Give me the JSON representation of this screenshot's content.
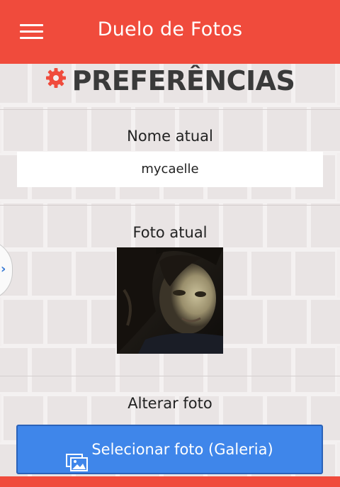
{
  "app": {
    "title": "Duelo de Fotos",
    "accent_color": "#f04b3c",
    "menu_icon": "hamburger-menu-icon"
  },
  "page": {
    "heading": "PREFERÊNCIAS",
    "heading_icon": "gear-icon"
  },
  "current_name": {
    "label": "Nome atual",
    "value": "mycaelle"
  },
  "current_photo": {
    "label": "Foto atual"
  },
  "change_photo": {
    "label": "Alterar foto",
    "button_label": "Selecionar foto (Galeria)",
    "button_icon": "gallery-images-icon",
    "button_color": "#3f86ea"
  },
  "side_drawer": {
    "icon": "chevron-right-icon"
  }
}
